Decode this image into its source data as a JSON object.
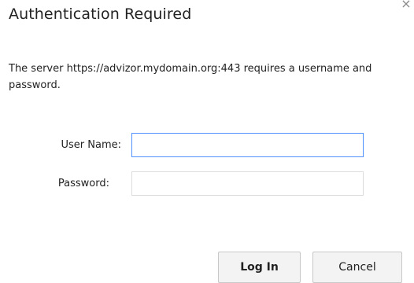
{
  "dialog": {
    "title": "Authentication Required",
    "close_glyph": "×",
    "message": "The server https://advizor.mydomain.org:443 requires a username and password."
  },
  "form": {
    "username_label": "User Name:",
    "username_value": "",
    "password_label": "Password:",
    "password_value": ""
  },
  "buttons": {
    "login_label": "Log In",
    "cancel_label": "Cancel"
  },
  "icons": {
    "close": "close-icon"
  },
  "colors": {
    "focus_border": "#4d90fe",
    "field_border": "#dcdcdc",
    "button_bg": "#f3f3f3",
    "text": "#222222"
  }
}
